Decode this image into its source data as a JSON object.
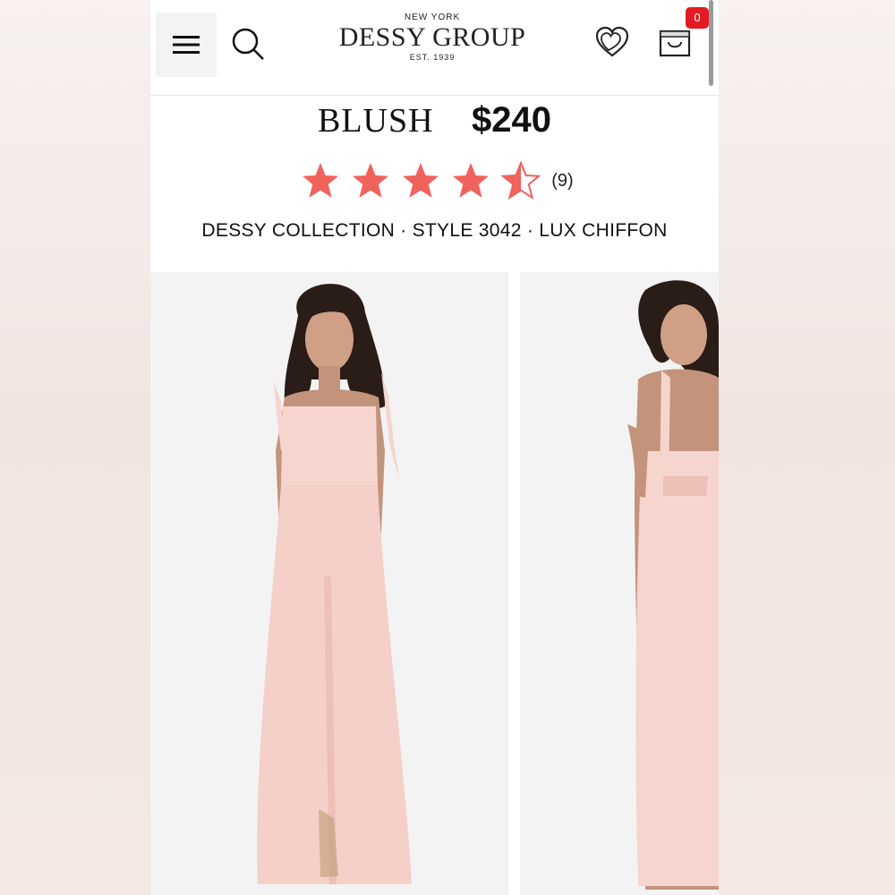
{
  "header": {
    "logo_top": "NEW YORK",
    "logo_main": "DESSY GROUP",
    "logo_est": "EST. 1939",
    "cart_count": "0",
    "icons": [
      "menu-icon",
      "search-icon",
      "heart-icon",
      "shopping-bag-icon"
    ]
  },
  "product": {
    "color": "BLUSH",
    "price": "$240",
    "rating": 4.5,
    "review_count": "(9)",
    "meta": "DESSY COLLECTION · STYLE 3042 · LUX CHIFFON"
  },
  "colors": {
    "star": "#f0625c",
    "badge": "#e01b22",
    "dress": "#f6d5cf",
    "skin": "#c99a82",
    "hair": "#2a1c16"
  }
}
